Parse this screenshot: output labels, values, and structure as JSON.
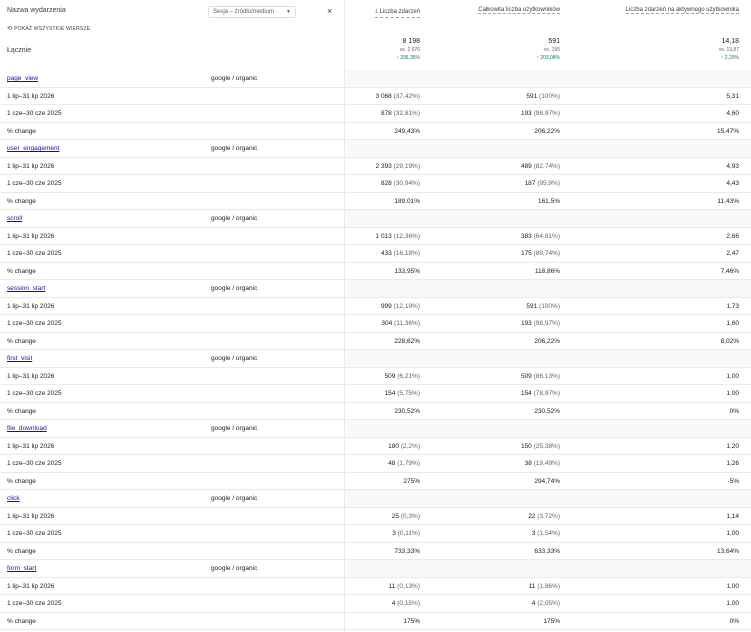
{
  "header": {
    "col1_title": "Nazwa wydarzenia",
    "dimension_select": "Sesja – źródło/medium",
    "close_glyph": "×",
    "show_all": "POKAŻ WSZYSTKIE WIERSZE",
    "show_all_icon": "⟲",
    "sort_icon": "🡓",
    "metrics": [
      "Liczba zdarzeń",
      "Całkowita liczba użytkowników",
      "Liczba zdarzeń na aktywnego użytkownika"
    ]
  },
  "totals": {
    "label": "Łącznie",
    "values": [
      {
        "value": "8 198",
        "sub": "vs. 2 676",
        "change": "↑ 206,35%"
      },
      {
        "value": "591",
        "sub": "vs. 195",
        "change": "↑ 203,08%"
      },
      {
        "value": "14,18",
        "sub": "vs. 13,87",
        "change": "↑ 2,29%"
      }
    ]
  },
  "events": [
    {
      "name": "page_view",
      "dimension": "google / organic",
      "rows": [
        {
          "label": "1 lip–31 lip 2026",
          "m1": "3 068",
          "m1p": "(37,42%)",
          "m2": "591",
          "m2p": "(100%)",
          "m3": "5,31"
        },
        {
          "label": "1 cze–30 cze 2025",
          "m1": "878",
          "m1p": "(32,81%)",
          "m2": "193",
          "m2p": "(98,97%)",
          "m3": "4,60"
        },
        {
          "label": "% change",
          "m1": "249,43%",
          "m1p": "",
          "m2": "206,22%",
          "m2p": "",
          "m3": "15,47%"
        }
      ]
    },
    {
      "name": "user_engagement",
      "dimension": "google / organic",
      "rows": [
        {
          "label": "1 lip–31 lip 2026",
          "m1": "2 393",
          "m1p": "(29,19%)",
          "m2": "489",
          "m2p": "(82,74%)",
          "m3": "4,93"
        },
        {
          "label": "1 cze–30 cze 2025",
          "m1": "828",
          "m1p": "(30,94%)",
          "m2": "187",
          "m2p": "(95,9%)",
          "m3": "4,43"
        },
        {
          "label": "% change",
          "m1": "189,01%",
          "m1p": "",
          "m2": "161,5%",
          "m2p": "",
          "m3": "11,43%"
        }
      ]
    },
    {
      "name": "scroll",
      "dimension": "google / organic",
      "rows": [
        {
          "label": "1 lip–31 lip 2026",
          "m1": "1 013",
          "m1p": "(12,36%)",
          "m2": "383",
          "m2p": "(64,81%)",
          "m3": "2,66"
        },
        {
          "label": "1 cze–30 cze 2025",
          "m1": "433",
          "m1p": "(16,18%)",
          "m2": "175",
          "m2p": "(89,74%)",
          "m3": "2,47"
        },
        {
          "label": "% change",
          "m1": "133,95%",
          "m1p": "",
          "m2": "118,86%",
          "m2p": "",
          "m3": "7,46%"
        }
      ]
    },
    {
      "name": "session_start",
      "dimension": "google / organic",
      "rows": [
        {
          "label": "1 lip–31 lip 2026",
          "m1": "999",
          "m1p": "(12,19%)",
          "m2": "591",
          "m2p": "(100%)",
          "m3": "1,73"
        },
        {
          "label": "1 cze–30 cze 2025",
          "m1": "304",
          "m1p": "(11,36%)",
          "m2": "193",
          "m2p": "(98,97%)",
          "m3": "1,60"
        },
        {
          "label": "% change",
          "m1": "228,62%",
          "m1p": "",
          "m2": "206,22%",
          "m2p": "",
          "m3": "8,02%"
        }
      ]
    },
    {
      "name": "first_visit",
      "dimension": "google / organic",
      "rows": [
        {
          "label": "1 lip–31 lip 2026",
          "m1": "509",
          "m1p": "(6,21%)",
          "m2": "509",
          "m2p": "(86,13%)",
          "m3": "1,00"
        },
        {
          "label": "1 cze–30 cze 2025",
          "m1": "154",
          "m1p": "(5,75%)",
          "m2": "154",
          "m2p": "(78,97%)",
          "m3": "1,00"
        },
        {
          "label": "% change",
          "m1": "230,52%",
          "m1p": "",
          "m2": "230,52%",
          "m2p": "",
          "m3": "0%"
        }
      ]
    },
    {
      "name": "file_download",
      "dimension": "google / organic",
      "rows": [
        {
          "label": "1 lip–31 lip 2026",
          "m1": "180",
          "m1p": "(2,2%)",
          "m2": "150",
          "m2p": "(25,38%)",
          "m3": "1,20"
        },
        {
          "label": "1 cze–30 cze 2025",
          "m1": "48",
          "m1p": "(1,79%)",
          "m2": "38",
          "m2p": "(19,49%)",
          "m3": "1,26"
        },
        {
          "label": "% change",
          "m1": "275%",
          "m1p": "",
          "m2": "294,74%",
          "m2p": "",
          "m3": "-5%"
        }
      ]
    },
    {
      "name": "click",
      "dimension": "google / organic",
      "rows": [
        {
          "label": "1 lip–31 lip 2026",
          "m1": "25",
          "m1p": "(0,3%)",
          "m2": "22",
          "m2p": "(3,72%)",
          "m3": "1,14"
        },
        {
          "label": "1 cze–30 cze 2025",
          "m1": "3",
          "m1p": "(0,11%)",
          "m2": "3",
          "m2p": "(1,54%)",
          "m3": "1,00"
        },
        {
          "label": "% change",
          "m1": "733,33%",
          "m1p": "",
          "m2": "633,33%",
          "m2p": "",
          "m3": "13,64%"
        }
      ]
    },
    {
      "name": "form_start",
      "dimension": "google / organic",
      "rows": [
        {
          "label": "1 lip–31 lip 2026",
          "m1": "11",
          "m1p": "(0,13%)",
          "m2": "11",
          "m2p": "(1,86%)",
          "m3": "1,00"
        },
        {
          "label": "1 cze–30 cze 2025",
          "m1": "4",
          "m1p": "(0,15%)",
          "m2": "4",
          "m2p": "(2,05%)",
          "m3": "1,00"
        },
        {
          "label": "% change",
          "m1": "175%",
          "m1p": "",
          "m2": "175%",
          "m2p": "",
          "m3": "0%"
        }
      ]
    }
  ]
}
